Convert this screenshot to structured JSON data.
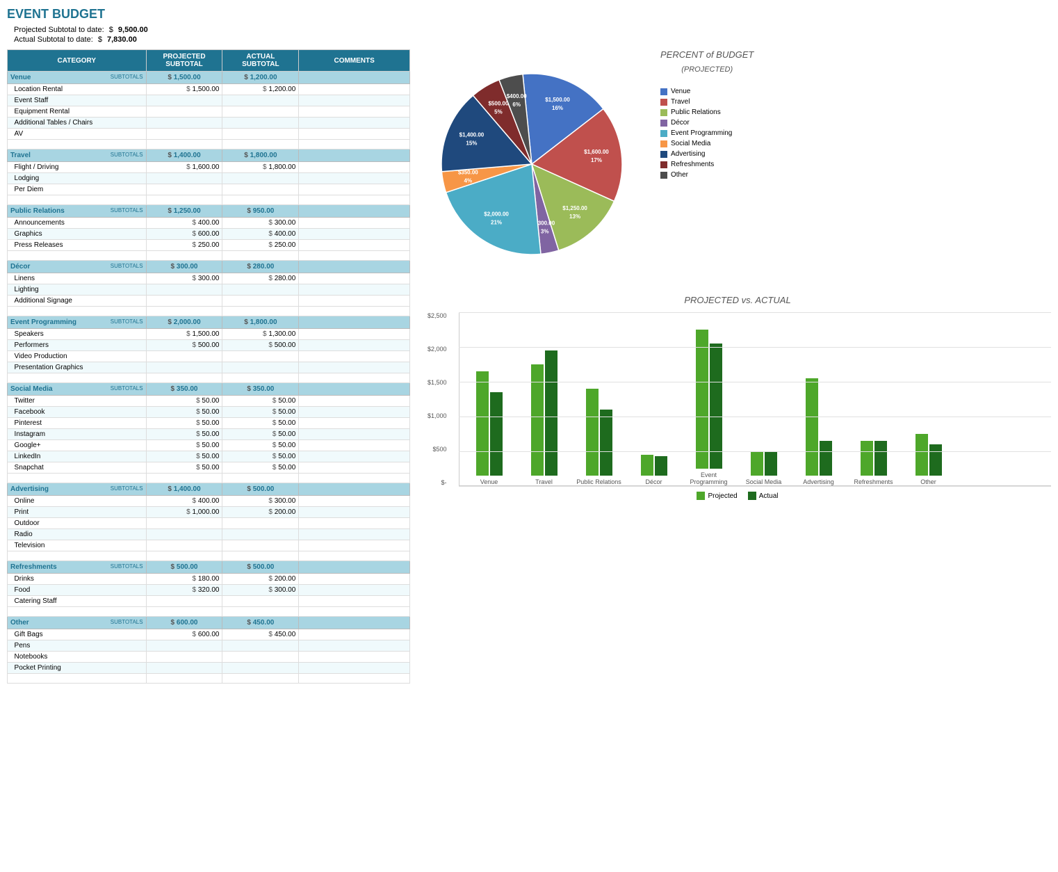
{
  "title": "EVENT BUDGET",
  "projected_subtotal_label": "Projected Subtotal to date:",
  "projected_subtotal_value": "9,500.00",
  "actual_subtotal_label": "Actual Subtotal to date:",
  "actual_subtotal_value": "7,830.00",
  "dollar_sign": "$",
  "table": {
    "headers": [
      "CATEGORY",
      "PROJECTED SUBTOTAL",
      "ACTUAL SUBTOTAL",
      "COMMENTS"
    ],
    "sections": [
      {
        "name": "Venue",
        "proj_subtotal": "1,500.00",
        "actual_subtotal": "1,200.00",
        "items": [
          {
            "name": "Location Rental",
            "proj": "1,500.00",
            "actual": "1,200.00"
          },
          {
            "name": "Event Staff",
            "proj": "",
            "actual": ""
          },
          {
            "name": "Equipment Rental",
            "proj": "",
            "actual": ""
          },
          {
            "name": "Additional Tables / Chairs",
            "proj": "",
            "actual": ""
          },
          {
            "name": "AV",
            "proj": "",
            "actual": ""
          }
        ]
      },
      {
        "name": "Travel",
        "proj_subtotal": "1,400.00",
        "actual_subtotal": "1,800.00",
        "items": [
          {
            "name": "Flight / Driving",
            "proj": "1,600.00",
            "actual": "1,800.00"
          },
          {
            "name": "Lodging",
            "proj": "",
            "actual": ""
          },
          {
            "name": "Per Diem",
            "proj": "",
            "actual": ""
          }
        ]
      },
      {
        "name": "Public Relations",
        "proj_subtotal": "1,250.00",
        "actual_subtotal": "950.00",
        "items": [
          {
            "name": "Announcements",
            "proj": "400.00",
            "actual": "300.00"
          },
          {
            "name": "Graphics",
            "proj": "600.00",
            "actual": "400.00"
          },
          {
            "name": "Press Releases",
            "proj": "250.00",
            "actual": "250.00"
          }
        ]
      },
      {
        "name": "Décor",
        "proj_subtotal": "300.00",
        "actual_subtotal": "280.00",
        "items": [
          {
            "name": "Linens",
            "proj": "300.00",
            "actual": "280.00"
          },
          {
            "name": "Lighting",
            "proj": "",
            "actual": ""
          },
          {
            "name": "Additional Signage",
            "proj": "",
            "actual": ""
          }
        ]
      },
      {
        "name": "Event Programming",
        "proj_subtotal": "2,000.00",
        "actual_subtotal": "1,800.00",
        "items": [
          {
            "name": "Speakers",
            "proj": "1,500.00",
            "actual": "1,300.00"
          },
          {
            "name": "Performers",
            "proj": "500.00",
            "actual": "500.00"
          },
          {
            "name": "Video Production",
            "proj": "",
            "actual": ""
          },
          {
            "name": "Presentation Graphics",
            "proj": "",
            "actual": ""
          }
        ]
      },
      {
        "name": "Social Media",
        "proj_subtotal": "350.00",
        "actual_subtotal": "350.00",
        "items": [
          {
            "name": "Twitter",
            "proj": "50.00",
            "actual": "50.00"
          },
          {
            "name": "Facebook",
            "proj": "50.00",
            "actual": "50.00"
          },
          {
            "name": "Pinterest",
            "proj": "50.00",
            "actual": "50.00"
          },
          {
            "name": "Instagram",
            "proj": "50.00",
            "actual": "50.00"
          },
          {
            "name": "Google+",
            "proj": "50.00",
            "actual": "50.00"
          },
          {
            "name": "LinkedIn",
            "proj": "50.00",
            "actual": "50.00"
          },
          {
            "name": "Snapchat",
            "proj": "50.00",
            "actual": "50.00"
          }
        ]
      },
      {
        "name": "Advertising",
        "proj_subtotal": "1,400.00",
        "actual_subtotal": "500.00",
        "items": [
          {
            "name": "Online",
            "proj": "400.00",
            "actual": "300.00"
          },
          {
            "name": "Print",
            "proj": "1,000.00",
            "actual": "200.00"
          },
          {
            "name": "Outdoor",
            "proj": "",
            "actual": ""
          },
          {
            "name": "Radio",
            "proj": "",
            "actual": ""
          },
          {
            "name": "Television",
            "proj": "",
            "actual": ""
          }
        ]
      },
      {
        "name": "Refreshments",
        "proj_subtotal": "500.00",
        "actual_subtotal": "500.00",
        "items": [
          {
            "name": "Drinks",
            "proj": "180.00",
            "actual": "200.00"
          },
          {
            "name": "Food",
            "proj": "320.00",
            "actual": "300.00"
          },
          {
            "name": "Catering Staff",
            "proj": "",
            "actual": ""
          }
        ]
      },
      {
        "name": "Other",
        "proj_subtotal": "600.00",
        "actual_subtotal": "450.00",
        "items": [
          {
            "name": "Gift Bags",
            "proj": "600.00",
            "actual": "450.00"
          },
          {
            "name": "Pens",
            "proj": "",
            "actual": ""
          },
          {
            "name": "Notebooks",
            "proj": "",
            "actual": ""
          },
          {
            "name": "Pocket Printing",
            "proj": "",
            "actual": ""
          }
        ]
      }
    ]
  },
  "pie_chart": {
    "title": "PERCENT of BUDGET",
    "subtitle": "(PROJECTED)",
    "slices": [
      {
        "label": "Venue",
        "value": 1500,
        "pct": "16%",
        "color": "#4472c4"
      },
      {
        "label": "Travel",
        "value": 1600,
        "pct": "17%",
        "color": "#c0504d"
      },
      {
        "label": "Public Relations",
        "value": 1250,
        "pct": "13%",
        "color": "#9bbb59"
      },
      {
        "label": "Décor",
        "value": 300,
        "pct": "3%",
        "color": "#8064a2"
      },
      {
        "label": "Event Programming",
        "value": 2000,
        "pct": "21%",
        "color": "#4bacc6"
      },
      {
        "label": "Social Media",
        "value": 350,
        "pct": "4%",
        "color": "#f79646"
      },
      {
        "label": "Advertising",
        "value": 1400,
        "pct": "15%",
        "color": "#1f497d"
      },
      {
        "label": "Refreshments",
        "value": 500,
        "pct": "5%",
        "color": "#7f2c2c"
      },
      {
        "label": "Other",
        "value": 400,
        "pct": "6%",
        "color": "#4d4d4d"
      }
    ],
    "legend": [
      {
        "label": "Venue",
        "color": "#4472c4"
      },
      {
        "label": "Travel",
        "color": "#c0504d"
      },
      {
        "label": "Public Relations",
        "color": "#9bbb59"
      },
      {
        "label": "Décor",
        "color": "#8064a2"
      },
      {
        "label": "Event Programming",
        "color": "#4bacc6"
      },
      {
        "label": "Social Media",
        "color": "#f79646"
      },
      {
        "label": "Advertising",
        "color": "#1f497d"
      },
      {
        "label": "Refreshments",
        "color": "#7f2c2c"
      },
      {
        "label": "Other",
        "color": "#4d4d4d"
      }
    ]
  },
  "bar_chart": {
    "title": "PROJECTED vs. ACTUAL",
    "y_labels": [
      "$2,500",
      "$2,000",
      "$1,500",
      "$1,000",
      "$500",
      "$-"
    ],
    "groups": [
      {
        "label": "Venue",
        "projected": 1500,
        "actual": 1200
      },
      {
        "label": "Travel",
        "projected": 1600,
        "actual": 1800
      },
      {
        "label": "Public Relations",
        "projected": 1250,
        "actual": 950
      },
      {
        "label": "Décor",
        "projected": 300,
        "actual": 280
      },
      {
        "label": "Event Programming",
        "projected": 2000,
        "actual": 1800
      },
      {
        "label": "Social Media",
        "projected": 350,
        "actual": 350
      },
      {
        "label": "Advertising",
        "projected": 1400,
        "actual": 500
      },
      {
        "label": "Refreshments",
        "projected": 500,
        "actual": 500
      },
      {
        "label": "Other",
        "projected": 600,
        "actual": 450
      }
    ],
    "projected_color": "#4ea72a",
    "actual_color": "#1e6b1e",
    "projected_label": "Projected",
    "actual_label": "Actual"
  }
}
